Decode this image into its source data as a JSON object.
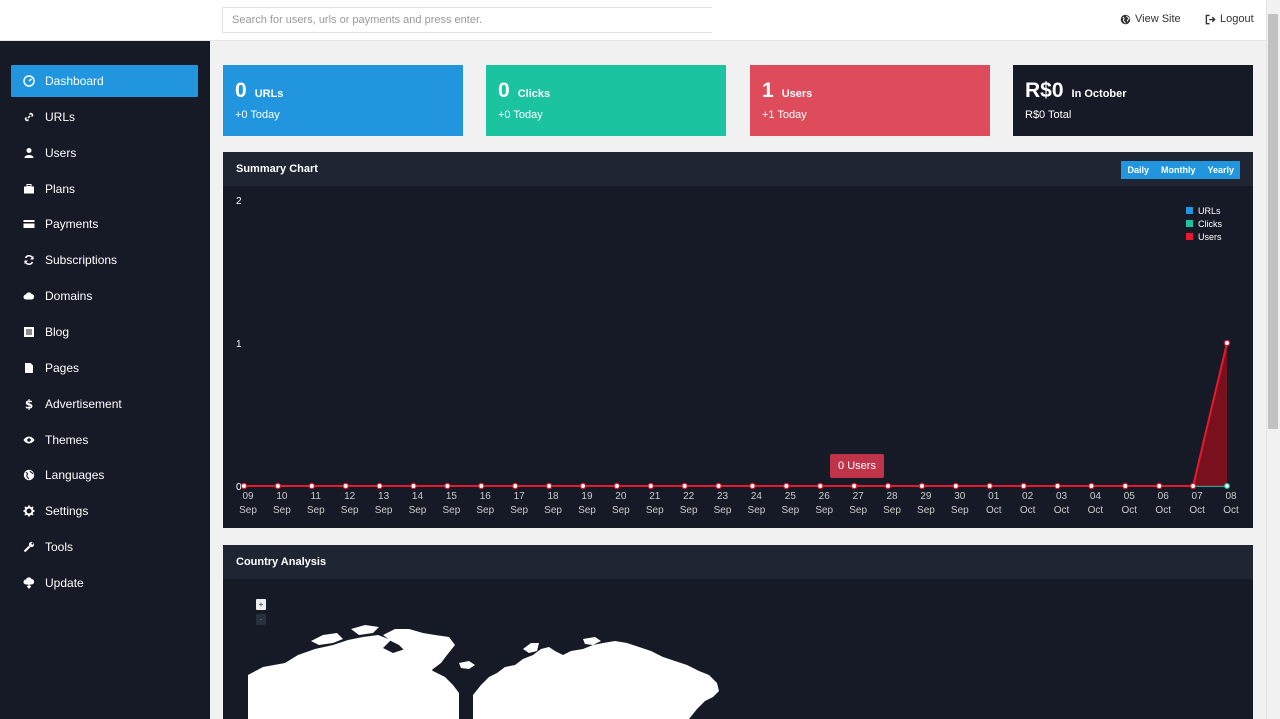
{
  "header": {
    "search_placeholder": "Search for users, urls or payments and press enter.",
    "view_site": "View Site",
    "logout": "Logout"
  },
  "sidebar": {
    "items": [
      {
        "label": "Dashboard",
        "icon": "dashboard-icon",
        "active": true
      },
      {
        "label": "URLs",
        "icon": "link-icon"
      },
      {
        "label": "Users",
        "icon": "user-icon"
      },
      {
        "label": "Plans",
        "icon": "briefcase-icon"
      },
      {
        "label": "Payments",
        "icon": "credit-card-icon"
      },
      {
        "label": "Subscriptions",
        "icon": "refresh-icon"
      },
      {
        "label": "Domains",
        "icon": "cloud-icon"
      },
      {
        "label": "Blog",
        "icon": "list-icon"
      },
      {
        "label": "Pages",
        "icon": "file-icon"
      },
      {
        "label": "Advertisement",
        "icon": "dollar-icon"
      },
      {
        "label": "Themes",
        "icon": "eye-icon"
      },
      {
        "label": "Languages",
        "icon": "globe-icon"
      },
      {
        "label": "Settings",
        "icon": "gear-icon"
      },
      {
        "label": "Tools",
        "icon": "wrench-icon"
      },
      {
        "label": "Update",
        "icon": "cloud-download-icon"
      }
    ]
  },
  "stats": [
    {
      "value": "0",
      "label": "URLs",
      "sub": "+0 Today",
      "color": "#2196df"
    },
    {
      "value": "0",
      "label": "Clicks",
      "sub": "+0 Today",
      "color": "#1cc3a1"
    },
    {
      "value": "1",
      "label": "Users",
      "sub": "+1 Today",
      "color": "#de4c5c"
    },
    {
      "value": "R$0",
      "label": "In October",
      "sub": "R$0 Total",
      "color": "#161a26"
    }
  ],
  "summary": {
    "title": "Summary Chart",
    "buttons": [
      "Daily",
      "Monthly",
      "Yearly"
    ],
    "tooltip": "0 Users"
  },
  "country": {
    "title": "Country Analysis",
    "zoom_in": "+",
    "zoom_out": "-"
  },
  "colors": {
    "urls": "#2196df",
    "clicks": "#1cc3a1",
    "users": "#e8192c",
    "panel": "#161a26",
    "panel_head": "#202534"
  },
  "chart_data": {
    "type": "area",
    "x": [
      [
        "09",
        "Sep"
      ],
      [
        "10",
        "Sep"
      ],
      [
        "11",
        "Sep"
      ],
      [
        "12",
        "Sep"
      ],
      [
        "13",
        "Sep"
      ],
      [
        "14",
        "Sep"
      ],
      [
        "15",
        "Sep"
      ],
      [
        "16",
        "Sep"
      ],
      [
        "17",
        "Sep"
      ],
      [
        "18",
        "Sep"
      ],
      [
        "19",
        "Sep"
      ],
      [
        "20",
        "Sep"
      ],
      [
        "21",
        "Sep"
      ],
      [
        "22",
        "Sep"
      ],
      [
        "23",
        "Sep"
      ],
      [
        "24",
        "Sep"
      ],
      [
        "25",
        "Sep"
      ],
      [
        "26",
        "Sep"
      ],
      [
        "27",
        "Sep"
      ],
      [
        "28",
        "Sep"
      ],
      [
        "29",
        "Sep"
      ],
      [
        "30",
        "Sep"
      ],
      [
        "01",
        "Oct"
      ],
      [
        "02",
        "Oct"
      ],
      [
        "03",
        "Oct"
      ],
      [
        "04",
        "Oct"
      ],
      [
        "05",
        "Oct"
      ],
      [
        "06",
        "Oct"
      ],
      [
        "07",
        "Oct"
      ],
      [
        "08",
        "Oct"
      ]
    ],
    "series": [
      {
        "name": "URLs",
        "values": [
          0,
          0,
          0,
          0,
          0,
          0,
          0,
          0,
          0,
          0,
          0,
          0,
          0,
          0,
          0,
          0,
          0,
          0,
          0,
          0,
          0,
          0,
          0,
          0,
          0,
          0,
          0,
          0,
          0,
          0
        ]
      },
      {
        "name": "Clicks",
        "values": [
          0,
          0,
          0,
          0,
          0,
          0,
          0,
          0,
          0,
          0,
          0,
          0,
          0,
          0,
          0,
          0,
          0,
          0,
          0,
          0,
          0,
          0,
          0,
          0,
          0,
          0,
          0,
          0,
          0,
          0
        ]
      },
      {
        "name": "Users",
        "values": [
          0,
          0,
          0,
          0,
          0,
          0,
          0,
          0,
          0,
          0,
          0,
          0,
          0,
          0,
          0,
          0,
          0,
          0,
          0,
          0,
          0,
          0,
          0,
          0,
          0,
          0,
          0,
          0,
          0,
          1
        ]
      }
    ],
    "yticks": [
      "0",
      "1",
      "2"
    ],
    "ylim": [
      0,
      2
    ],
    "legend": "top-right",
    "grid": false
  }
}
